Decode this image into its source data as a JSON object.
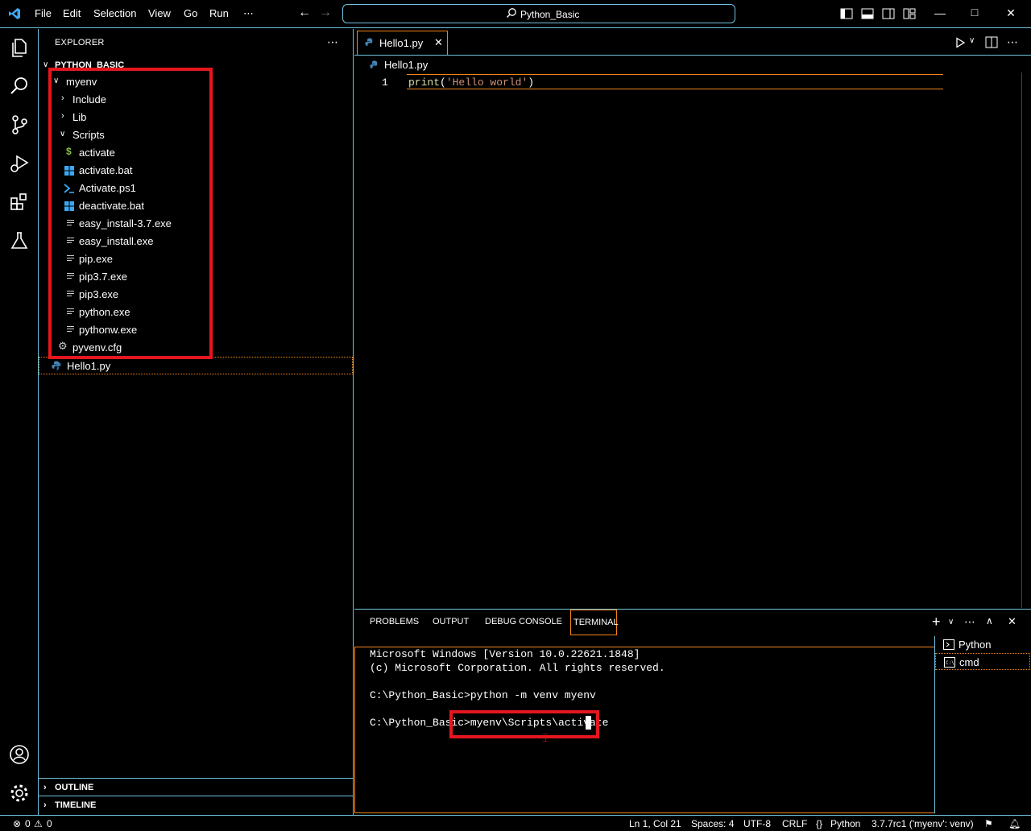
{
  "titlebar": {
    "menus": [
      "File",
      "Edit",
      "Selection",
      "View",
      "Go",
      "Run",
      "⋯"
    ],
    "search_text": "Python_Basic"
  },
  "sidebar": {
    "title": "EXPLORER",
    "more": "⋯",
    "root": "PYTHON_BASIC",
    "tree": {
      "myenv": "myenv",
      "include": "Include",
      "lib": "Lib",
      "scripts": "Scripts",
      "files": [
        "activate",
        "activate.bat",
        "Activate.ps1",
        "deactivate.bat",
        "easy_install-3.7.exe",
        "easy_install.exe",
        "pip.exe",
        "pip3.7.exe",
        "pip3.exe",
        "python.exe",
        "pythonw.exe"
      ],
      "pyvenv": "pyvenv.cfg",
      "hello": "Hello1.py"
    },
    "outline": "OUTLINE",
    "timeline": "TIMELINE"
  },
  "editor": {
    "tab_label": "Hello1.py",
    "breadcrumb": "Hello1.py",
    "line_number": "1",
    "code_func": "print",
    "code_open": "(",
    "code_str": "'Hello world'",
    "code_close": ")"
  },
  "panel": {
    "tabs": [
      "PROBLEMS",
      "OUTPUT",
      "DEBUG CONSOLE",
      "TERMINAL"
    ],
    "terminal_lines": [
      "Microsoft Windows [Version 10.0.22621.1848]",
      "(c) Microsoft Corporation. All rights reserved.",
      "C:\\Python_Basic>python -m venv myenv",
      "C:\\Python_Basic>myenv\\Scripts\\activate"
    ],
    "terminals": [
      "Python",
      "cmd"
    ]
  },
  "statusbar": {
    "errors": "0",
    "warnings": "0",
    "position": "Ln 1, Col 21",
    "spaces": "Spaces: 4",
    "encoding": "UTF-8",
    "eol": "CRLF",
    "language": "Python",
    "interpreter": "3.7.7rc1 ('myenv': venv)"
  },
  "colors": {
    "accent_border": "#6fc3df",
    "focus_border": "#f38518",
    "highlight_red": "#e5161e",
    "string_color": "#ce9178",
    "func_color": "#dcdcaa"
  }
}
